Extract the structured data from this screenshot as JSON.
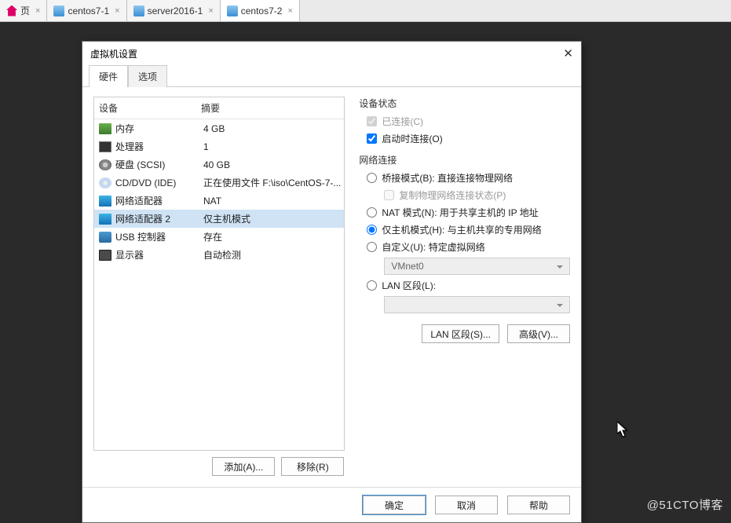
{
  "outerTabs": {
    "t1": "页",
    "t2": "centos7-1",
    "t3": "server2016-1",
    "t4": "centos7-2"
  },
  "dialog": {
    "title": "虚拟机设置",
    "tabHardware": "硬件",
    "tabOptions": "选项",
    "colDevice": "设备",
    "colSummary": "摘要"
  },
  "devices": [
    {
      "icon": "ic-mem",
      "name": "内存",
      "summary": "4 GB"
    },
    {
      "icon": "ic-cpu",
      "name": "处理器",
      "summary": "1"
    },
    {
      "icon": "ic-disk",
      "name": "硬盘 (SCSI)",
      "summary": "40 GB"
    },
    {
      "icon": "ic-cd",
      "name": "CD/DVD (IDE)",
      "summary": "正在使用文件 F:\\iso\\CentOS-7-..."
    },
    {
      "icon": "ic-net",
      "name": "网络适配器",
      "summary": "NAT"
    },
    {
      "icon": "ic-net",
      "name": "网络适配器 2",
      "summary": "仅主机模式"
    },
    {
      "icon": "ic-usb",
      "name": "USB 控制器",
      "summary": "存在"
    },
    {
      "icon": "ic-mon",
      "name": "显示器",
      "summary": "自动检测"
    }
  ],
  "leftButtons": {
    "add": "添加(A)...",
    "remove": "移除(R)"
  },
  "rightPane": {
    "statusTitle": "设备状态",
    "connected": "已连接(C)",
    "connectAtPowerOn": "启动时连接(O)",
    "netTitle": "网络连接",
    "bridged": "桥接模式(B): 直接连接物理网络",
    "replicate": "复制物理网络连接状态(P)",
    "nat": "NAT 模式(N): 用于共享主机的 IP 地址",
    "hostonly": "仅主机模式(H): 与主机共享的专用网络",
    "custom": "自定义(U): 特定虚拟网络",
    "vmnet": "VMnet0",
    "lanseg": "LAN 区段(L):",
    "lanBtn": "LAN 区段(S)...",
    "advBtn": "高级(V)..."
  },
  "footer": {
    "ok": "确定",
    "cancel": "取消",
    "help": "帮助"
  },
  "watermark": "@51CTO博客"
}
